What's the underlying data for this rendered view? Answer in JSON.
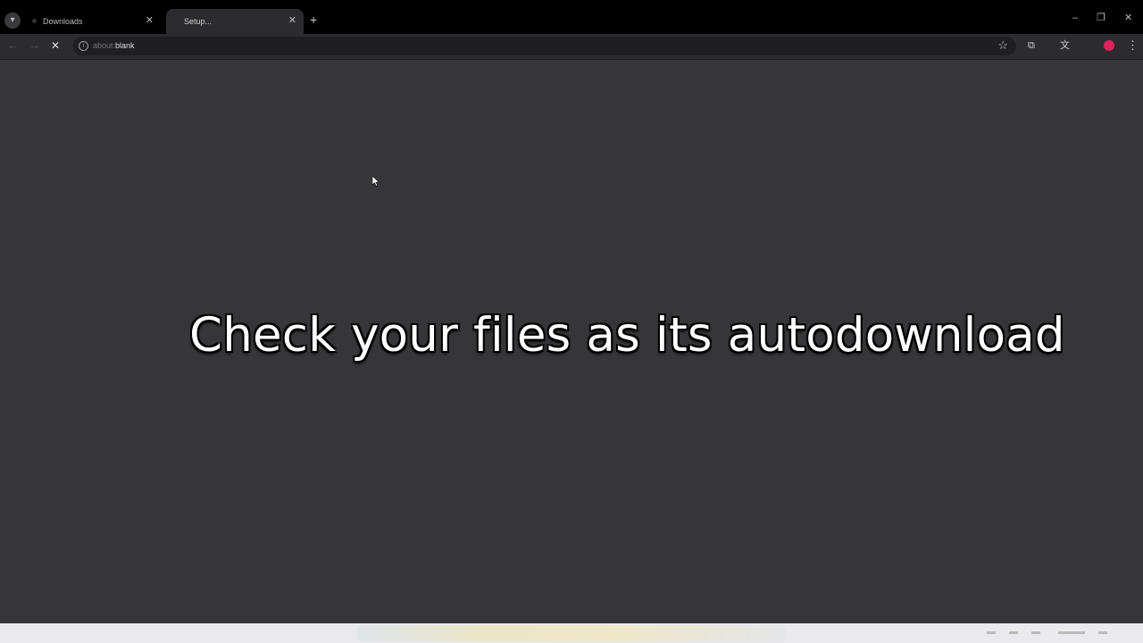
{
  "browser": {
    "tab_list_icon": "chevron-down-icon",
    "tabs": [
      {
        "title": "Downloads",
        "close": "✕",
        "active": false
      },
      {
        "title": "Setup...",
        "close": "✕",
        "active": true
      }
    ],
    "new_tab": "+",
    "window_controls": {
      "minimize": "–",
      "restore": "❐",
      "close": "✕"
    },
    "toolbar": {
      "back": "←",
      "forward": "→",
      "stop": "✕",
      "url_scheme": "about:",
      "url_path": "blank",
      "bookmark": "☆",
      "extensions": "⧉",
      "translate": "文",
      "menu": "⋮"
    }
  },
  "page": {
    "caption": "Check your files as its autodownload"
  },
  "colors": {
    "tab_bar": "#000000",
    "toolbar": "#2c2c2e",
    "page_background": "#363638",
    "profile_accent": "#e0245e"
  }
}
